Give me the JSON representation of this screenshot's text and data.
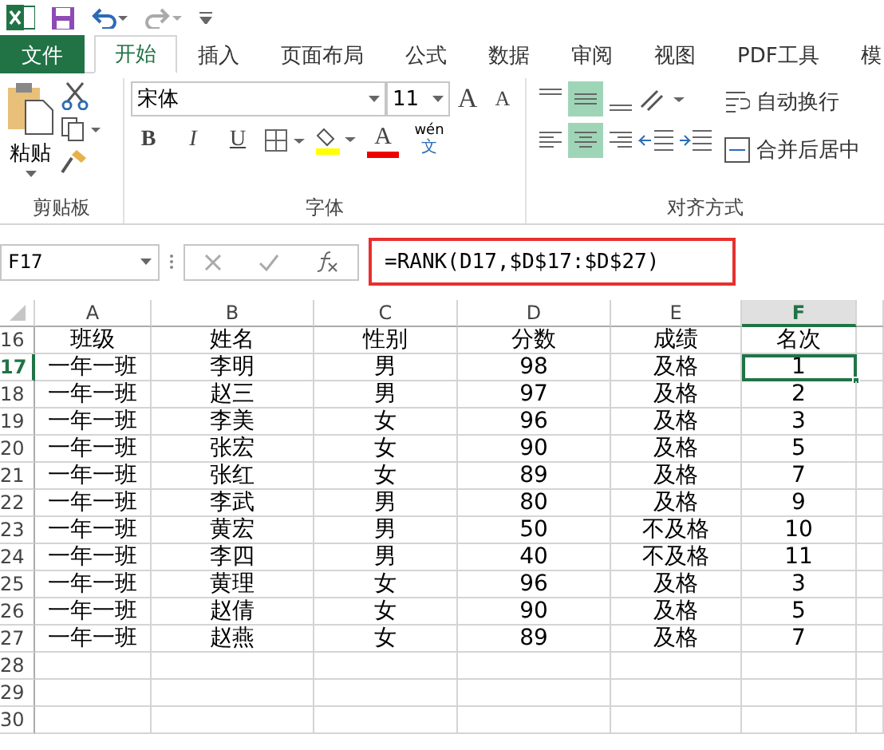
{
  "tabs": [
    {
      "label": "文件",
      "kind": "file",
      "selected": false
    },
    {
      "label": "开始",
      "kind": "tab",
      "selected": true
    },
    {
      "label": "插入",
      "kind": "tab",
      "selected": false
    },
    {
      "label": "页面布局",
      "kind": "tab",
      "selected": false
    },
    {
      "label": "公式",
      "kind": "tab",
      "selected": false
    },
    {
      "label": "数据",
      "kind": "tab",
      "selected": false
    },
    {
      "label": "审阅",
      "kind": "tab",
      "selected": false
    },
    {
      "label": "视图",
      "kind": "tab",
      "selected": false
    },
    {
      "label": "PDF工具",
      "kind": "tab",
      "selected": false
    },
    {
      "label": "模",
      "kind": "tab",
      "selected": false
    }
  ],
  "ribbon": {
    "clipboard": {
      "paste_label": "粘贴",
      "group_label": "剪贴板"
    },
    "font": {
      "font_name": "宋体",
      "font_size": "11",
      "grow": "A",
      "shrink": "A",
      "bold": "B",
      "italic": "I",
      "underline": "U",
      "font_color": "A",
      "phonetic_top": "wén",
      "phonetic_bottom": "文",
      "group_label": "字体"
    },
    "alignment": {
      "wrap_text": "自动换行",
      "merge_center": "合并后居中",
      "group_label": "对齐方式",
      "middle_align_selected": true,
      "center_selected": true
    }
  },
  "formula_bar": {
    "name_box": "F17",
    "formula": "=RANK(D17,$D$17:$D$27)",
    "highlighted": true
  },
  "columns": [
    {
      "label": "A",
      "selected": false
    },
    {
      "label": "B",
      "selected": false
    },
    {
      "label": "C",
      "selected": false
    },
    {
      "label": "D",
      "selected": false
    },
    {
      "label": "E",
      "selected": false
    },
    {
      "label": "F",
      "selected": true
    }
  ],
  "rows": [
    {
      "number": "16",
      "selected": false,
      "cells": [
        "班级",
        "姓名",
        "性别",
        "分数",
        "成绩",
        "名次"
      ]
    },
    {
      "number": "17",
      "selected": true,
      "cells": [
        "一年一班",
        "李明",
        "男",
        "98",
        "及格",
        "1"
      ]
    },
    {
      "number": "18",
      "selected": false,
      "cells": [
        "一年一班",
        "赵三",
        "男",
        "97",
        "及格",
        "2"
      ]
    },
    {
      "number": "19",
      "selected": false,
      "cells": [
        "一年一班",
        "李美",
        "女",
        "96",
        "及格",
        "3"
      ]
    },
    {
      "number": "20",
      "selected": false,
      "cells": [
        "一年一班",
        "张宏",
        "女",
        "90",
        "及格",
        "5"
      ]
    },
    {
      "number": "21",
      "selected": false,
      "cells": [
        "一年一班",
        "张红",
        "女",
        "89",
        "及格",
        "7"
      ]
    },
    {
      "number": "22",
      "selected": false,
      "cells": [
        "一年一班",
        "李武",
        "男",
        "80",
        "及格",
        "9"
      ]
    },
    {
      "number": "23",
      "selected": false,
      "cells": [
        "一年一班",
        "黄宏",
        "男",
        "50",
        "不及格",
        "10"
      ]
    },
    {
      "number": "24",
      "selected": false,
      "cells": [
        "一年一班",
        "李四",
        "男",
        "40",
        "不及格",
        "11"
      ]
    },
    {
      "number": "25",
      "selected": false,
      "cells": [
        "一年一班",
        "黄理",
        "女",
        "96",
        "及格",
        "3"
      ]
    },
    {
      "number": "26",
      "selected": false,
      "cells": [
        "一年一班",
        "赵倩",
        "女",
        "90",
        "及格",
        "5"
      ]
    },
    {
      "number": "27",
      "selected": false,
      "cells": [
        "一年一班",
        "赵燕",
        "女",
        "89",
        "及格",
        "7"
      ]
    },
    {
      "number": "28",
      "selected": false,
      "cells": []
    },
    {
      "number": "29",
      "selected": false,
      "cells": []
    },
    {
      "number": "30",
      "selected": false,
      "cells": []
    }
  ]
}
